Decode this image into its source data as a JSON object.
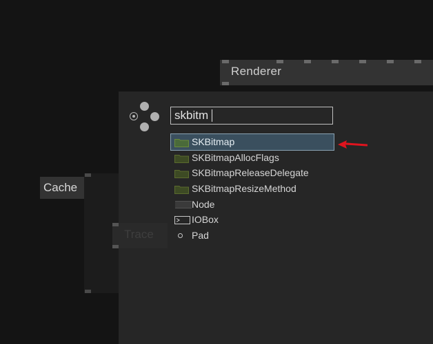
{
  "renderer": {
    "title": "Renderer"
  },
  "cache": {
    "title": "Cache"
  },
  "trace": {
    "title": "Trace"
  },
  "node_browser": {
    "search": {
      "value": "skbitm"
    },
    "results": [
      {
        "label": "SKBitmap",
        "icon": "folder-icon",
        "selected": true
      },
      {
        "label": "SKBitmapAllocFlags",
        "icon": "folder-icon"
      },
      {
        "label": "SKBitmapReleaseDelegate",
        "icon": "folder-icon"
      },
      {
        "label": "SKBitmapResizeMethod",
        "icon": "folder-icon"
      },
      {
        "label": "Node",
        "icon": "node-icon"
      },
      {
        "label": "IOBox",
        "icon": "iobox-icon"
      },
      {
        "label": "Pad",
        "icon": "pad-icon"
      }
    ]
  },
  "colors": {
    "background": "#141414",
    "panel": "#262626",
    "selection": "#3a4f5e",
    "folder": "#5b6b2e",
    "arrow": "#e0141e"
  }
}
